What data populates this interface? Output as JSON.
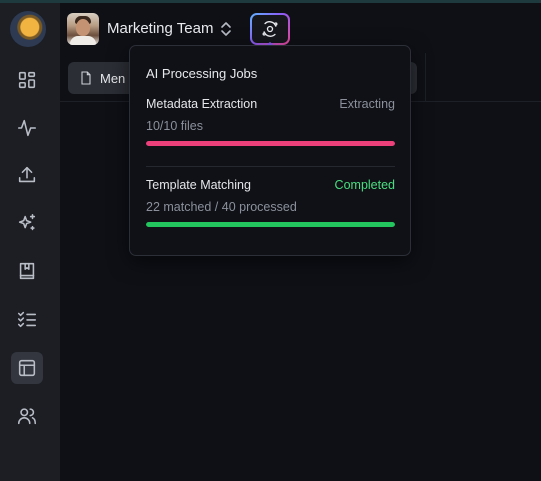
{
  "colors": {
    "sidebar_bg": "#1c1e24",
    "main_bg": "#0e1016",
    "accent_pink": "#ec407a",
    "accent_green": "#22c55e",
    "status_extracting": "#8b909a",
    "status_completed": "#4ade80"
  },
  "sidebar": {
    "logo_icon": "planet-logo-icon",
    "items": [
      {
        "icon": "dashboard-grid-icon",
        "active": false
      },
      {
        "icon": "activity-pulse-icon",
        "active": false
      },
      {
        "icon": "upload-icon",
        "active": false
      },
      {
        "icon": "sparkles-icon",
        "active": false
      },
      {
        "icon": "book-icon",
        "active": false
      },
      {
        "icon": "checklist-icon",
        "active": false
      },
      {
        "icon": "layout-table-icon",
        "active": true
      },
      {
        "icon": "users-icon",
        "active": false
      }
    ]
  },
  "header": {
    "team_name": "Marketing Team",
    "switcher_icon": "chevrons-up-down-icon",
    "ai_button_icon": "orbit-ai-icon"
  },
  "tab": {
    "label": "Men",
    "icon": "file-icon"
  },
  "popover": {
    "title": "AI Processing Jobs",
    "jobs": [
      {
        "name": "Metadata Extraction",
        "status": "Extracting",
        "detail": "10/10 files",
        "progress": 1.0
      },
      {
        "name": "Template Matching",
        "status": "Completed",
        "detail": "22 matched / 40 processed",
        "progress": 1.0
      }
    ]
  }
}
